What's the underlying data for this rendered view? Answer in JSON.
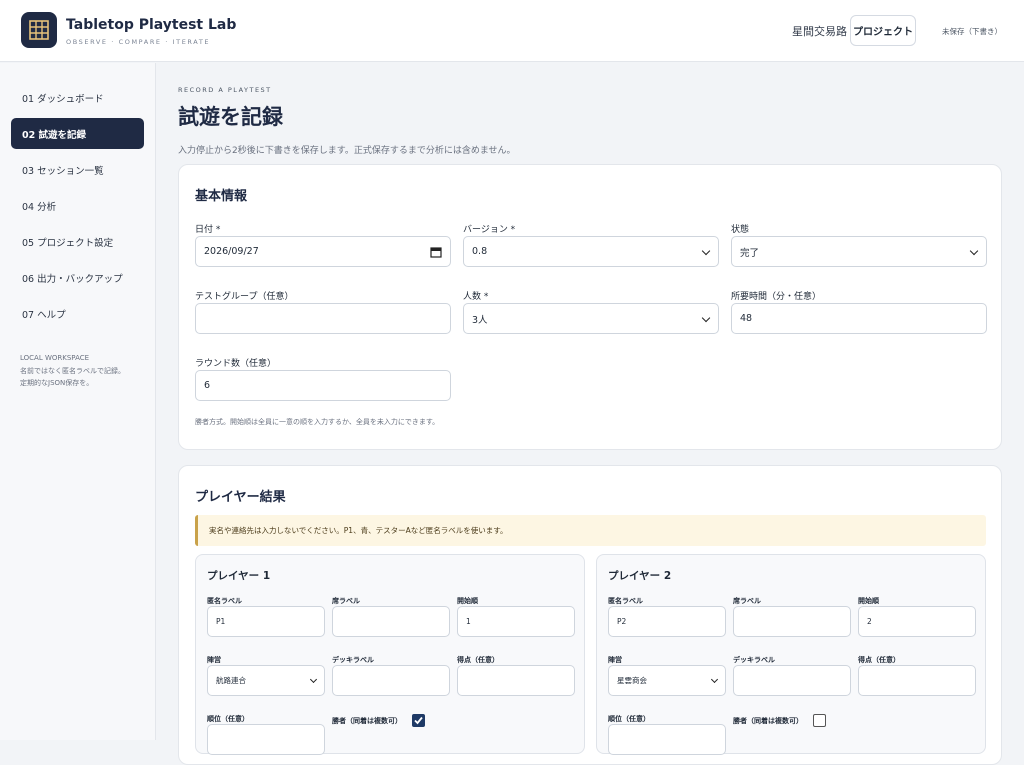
{
  "header": {
    "app_title": "Tabletop Playtest Lab",
    "app_subtitle": "OBSERVE · COMPARE · ITERATE",
    "project_name": "星間交易路",
    "project_button": "プロジェクト",
    "save_status": "未保存（下書き）"
  },
  "sidebar": {
    "items": [
      {
        "label": "01 ダッシュボード"
      },
      {
        "label": "02 試遊を記録"
      },
      {
        "label": "03 セッション一覧"
      },
      {
        "label": "04 分析"
      },
      {
        "label": "05 プロジェクト設定"
      },
      {
        "label": "06 出力・バックアップ"
      },
      {
        "label": "07 ヘルプ"
      }
    ],
    "active_index": 1,
    "note": {
      "line1": "LOCAL WORKSPACE",
      "line2": "名前ではなく匿名ラベルで記録。",
      "line3": "定期的なJSON保存を。"
    }
  },
  "page": {
    "eyebrow": "RECORD A PLAYTEST",
    "title": "試遊を記録",
    "description": "入力停止から2秒後に下書きを保存します。正式保存するまで分析には含めません。"
  },
  "basic": {
    "title": "基本情報",
    "date_label": "日付 *",
    "date_value": "2026/09/27",
    "version_label": "バージョン *",
    "version_value": "0.8",
    "status_label": "状態",
    "status_value": "完了",
    "group_label": "テストグループ（任意）",
    "group_value": "",
    "players_label": "人数 *",
    "players_value": "3人",
    "duration_label": "所要時間（分・任意）",
    "duration_value": "48",
    "rounds_label": "ラウンド数（任意）",
    "rounds_value": "6",
    "hint": "勝者方式。開始順は全員に一意の順を入力するか、全員を未入力にできます。"
  },
  "results": {
    "title": "プレイヤー結果",
    "notice": "実名や連絡先は入力しないでください。P1、青、テスターAなど匿名ラベルを使います。",
    "players": [
      {
        "title": "プレイヤー 1",
        "anon_label": "匿名ラベル",
        "anon_value": "P1",
        "seat_label": "席ラベル",
        "seat_value": "",
        "order_label": "開始順",
        "order_value": "1",
        "faction_label": "陣営",
        "faction_value": "航路連合",
        "deck_label": "デッキラベル",
        "deck_value": "",
        "score_label": "得点（任意）",
        "score_value": "",
        "rank_label": "順位（任意）",
        "rank_value": "",
        "winner_label": "勝者（同着は複数可）",
        "winner": true
      },
      {
        "title": "プレイヤー 2",
        "anon_label": "匿名ラベル",
        "anon_value": "P2",
        "seat_label": "席ラベル",
        "seat_value": "",
        "order_label": "開始順",
        "order_value": "2",
        "faction_label": "陣営",
        "faction_value": "星雲商会",
        "deck_label": "デッキラベル",
        "deck_value": "",
        "score_label": "得点（任意）",
        "score_value": "",
        "rank_label": "順位（任意）",
        "rank_value": "",
        "winner_label": "勝者（同着は複数可）",
        "winner": false
      }
    ]
  },
  "colors": {
    "navy": "#1f2a44",
    "checkbox_checked": "#1f3a66",
    "notice_bg": "#fdf6e3",
    "notice_border": "#c9a24a"
  }
}
